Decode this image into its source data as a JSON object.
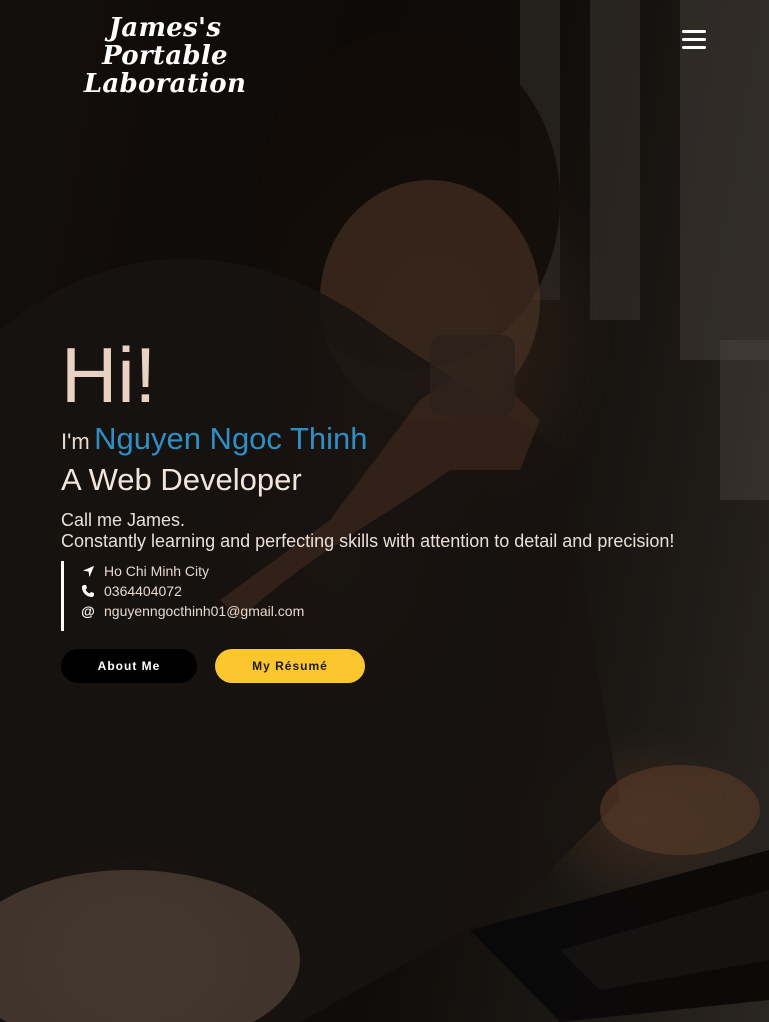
{
  "header": {
    "logo_line1": "James's Portable",
    "logo_line2": "Laboration",
    "menu_icon": "hamburger-menu-icon"
  },
  "hero": {
    "greeting": "Hi!",
    "intro_prefix": "I'm",
    "name": "Nguyen Ngoc Thinh",
    "role": "A Web Developer",
    "tagline_line1": "Call me James.",
    "tagline_line2": "Constantly learning and perfecting skills with attention to detail and precision!"
  },
  "contacts": [
    {
      "icon": "location-arrow-icon",
      "text": "Ho Chi Minh City"
    },
    {
      "icon": "phone-icon",
      "text": "0364404072"
    },
    {
      "icon": "at-sign-icon",
      "text": "nguyenngocthinh01@gmail.com"
    }
  ],
  "buttons": {
    "about_label": "About Me",
    "resume_label": "My Résumé"
  },
  "colors": {
    "name_accent": "#2f8ec4",
    "resume_button": "#fcc62e",
    "about_button": "#000000"
  }
}
